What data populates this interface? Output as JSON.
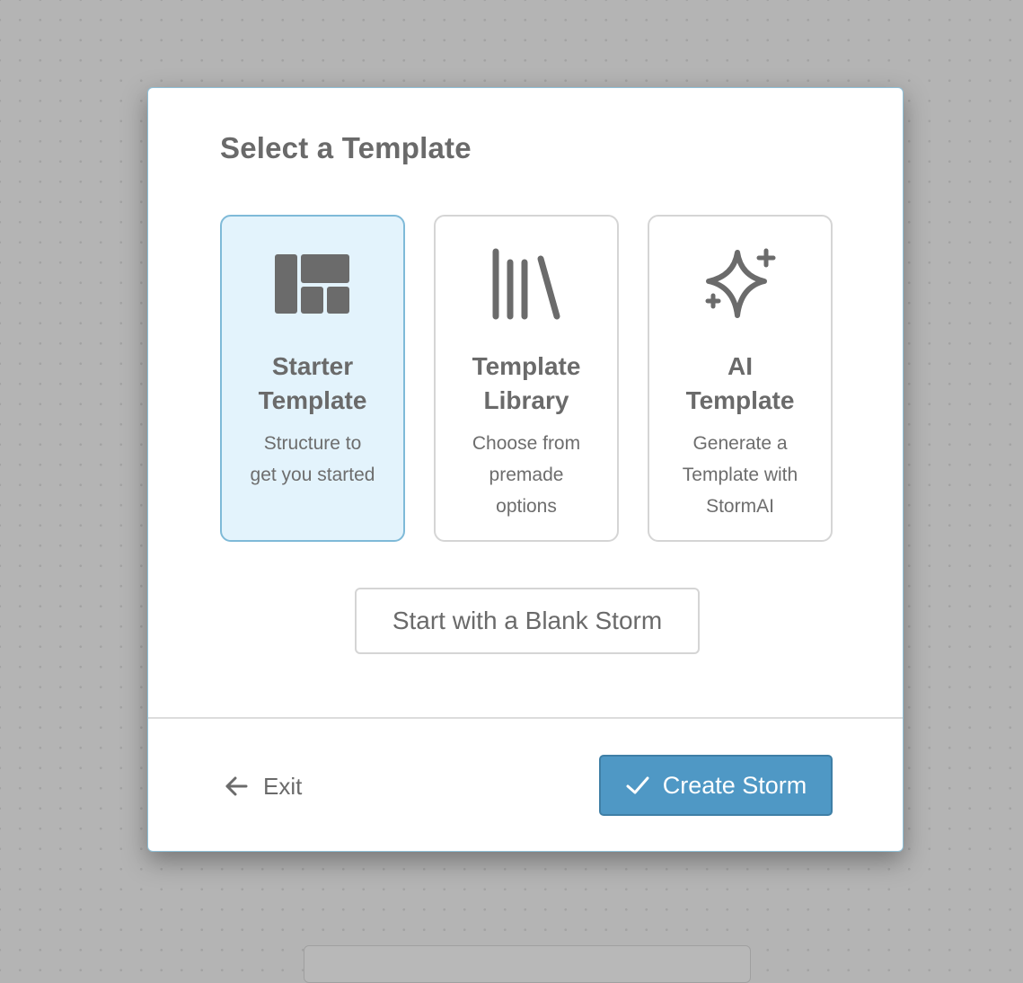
{
  "modal": {
    "title": "Select a Template"
  },
  "cards": [
    {
      "title_line1": "Starter",
      "title_line2": "Template",
      "desc_line1": "Structure to",
      "desc_line2": "get you started",
      "desc_line3": "",
      "icon": "layout-grid-icon",
      "selected": true
    },
    {
      "title_line1": "Template",
      "title_line2": "Library",
      "desc_line1": "Choose from",
      "desc_line2": "premade",
      "desc_line3": "options",
      "icon": "library-icon",
      "selected": false
    },
    {
      "title_line1": "AI",
      "title_line2": "Template",
      "desc_line1": "Generate a",
      "desc_line2": "Template with",
      "desc_line3": "StormAI",
      "icon": "sparkle-icon",
      "selected": false
    }
  ],
  "blank_button": {
    "label": "Start with a Blank Storm"
  },
  "footer": {
    "exit_label": "Exit",
    "exit_icon": "arrow-left-icon",
    "create_label": "Create Storm",
    "create_icon": "checkmark-icon"
  },
  "colors": {
    "accent": "#4f98c5",
    "selected_card_bg": "#e3f3fc",
    "selected_card_border": "#7fbad8",
    "text": "#6a6a6a",
    "backdrop": "#b4b4b4"
  }
}
